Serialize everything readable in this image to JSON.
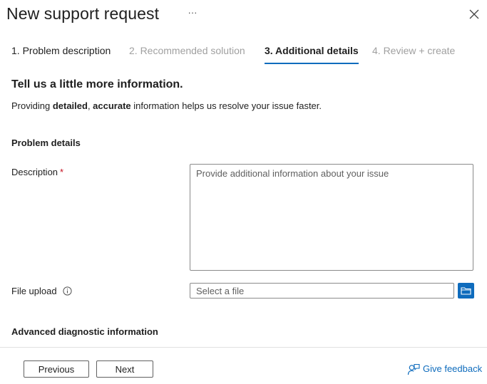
{
  "header": {
    "title": "New support request",
    "more_label": "···"
  },
  "tabs": [
    {
      "label": "1. Problem description",
      "state": "done"
    },
    {
      "label": "2. Recommended solution",
      "state": "disabled"
    },
    {
      "label": "3. Additional details",
      "state": "active"
    },
    {
      "label": "4. Review + create",
      "state": "disabled"
    }
  ],
  "intro": {
    "heading": "Tell us a little more information.",
    "text_prefix": "Providing ",
    "text_bold1": "detailed",
    "text_comma": ", ",
    "text_bold2": "accurate",
    "text_suffix": " information helps us resolve your issue faster."
  },
  "problem_details": {
    "heading": "Problem details",
    "description_label": "Description",
    "required_mark": "*",
    "description_value": "",
    "description_placeholder": "Provide additional information about your issue",
    "file_upload_label": "File upload",
    "file_value": "",
    "file_placeholder": "Select a file"
  },
  "advanced": {
    "heading": "Advanced diagnostic information"
  },
  "footer": {
    "previous_label": "Previous",
    "next_label": "Next",
    "feedback_label": "Give feedback"
  },
  "colors": {
    "accent": "#0f6cbd",
    "required": "#c50f1f",
    "disabled_text": "#a0a0a0"
  },
  "icons": {
    "more": "more-horizontal-icon",
    "close": "close-icon",
    "info": "info-icon",
    "browse": "folder-icon",
    "feedback": "person-feedback-icon"
  }
}
